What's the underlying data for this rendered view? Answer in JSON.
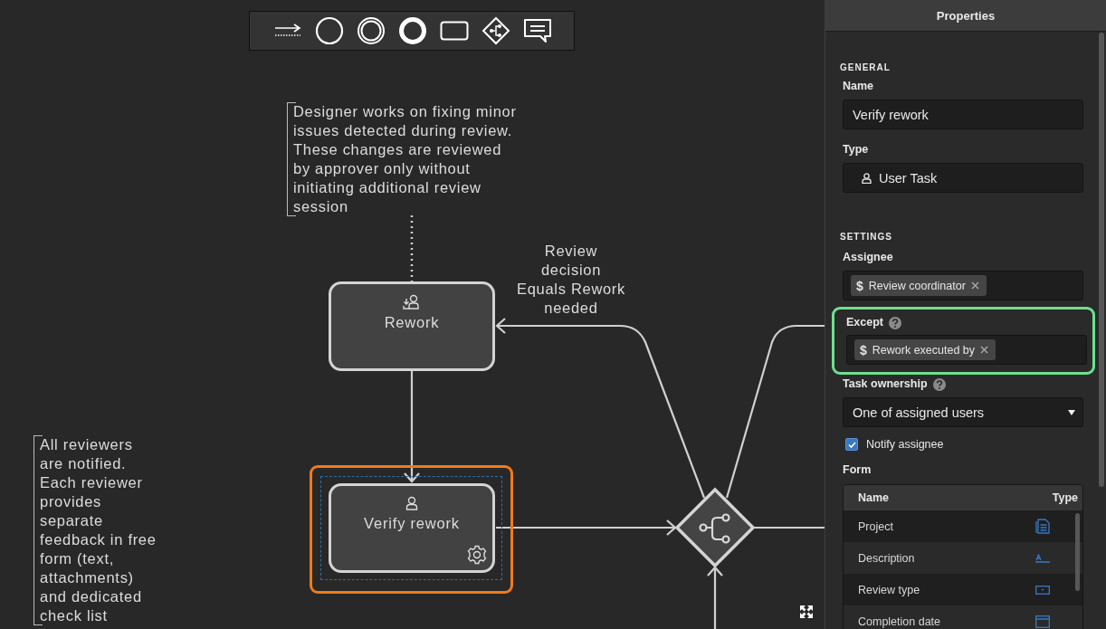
{
  "canvas": {
    "annotations": [
      {
        "text": "Designer works on fixing minor\nissues detected during review.\nThese changes are reviewed\nby approver only without\ninitiating additional review\nsession"
      },
      {
        "text": "All reviewers\nare notified.\nEach reviewer\nprovides\nseparate\nfeedback in free\nform (text,\nattachments)\nand dedicated\ncheck list"
      }
    ],
    "nodes": [
      {
        "label": "Rework",
        "kind": "reassign",
        "selected": false
      },
      {
        "label": "Verify rework",
        "kind": "user",
        "selected": true
      }
    ],
    "flow_label": "Review\ndecision\nEquals Rework\nneeded"
  },
  "properties": {
    "title": "Properties",
    "general": {
      "heading": "GENERAL",
      "name": {
        "label": "Name",
        "value": "Verify rework"
      },
      "type": {
        "label": "Type",
        "value": "User Task"
      }
    },
    "settings": {
      "heading": "SETTINGS",
      "assignee": {
        "label": "Assignee",
        "tags": [
          {
            "symbol": "$",
            "text": "Review coordinator"
          }
        ]
      },
      "except": {
        "label": "Except",
        "highlighted": true,
        "tags": [
          {
            "symbol": "$",
            "text": "Rework executed by"
          }
        ]
      },
      "task_ownership": {
        "label": "Task ownership",
        "value": "One of assigned users"
      },
      "notify_assignee": {
        "label": "Notify assignee",
        "checked": true
      },
      "form": {
        "label": "Form",
        "columns": [
          "Name",
          "Type"
        ],
        "rows": [
          {
            "name": "Project",
            "kind": "document"
          },
          {
            "name": "Description",
            "kind": "text"
          },
          {
            "name": "Review type",
            "kind": "dropdown"
          },
          {
            "name": "Completion date",
            "kind": "date"
          }
        ]
      }
    }
  }
}
